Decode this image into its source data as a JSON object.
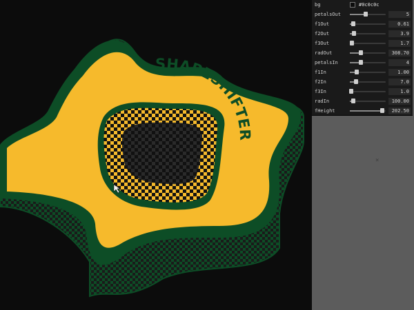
{
  "colors": {
    "background": "#0c0c0c",
    "ring": "#0d4d26",
    "text": "#f6ba2c",
    "checker_dark": "#1a1a1a"
  },
  "canvas_text": "SHAPESHIFTER",
  "gui": {
    "bg": {
      "label": "bg",
      "value": "#0c0c0c"
    },
    "controls": [
      {
        "label": "petalsOut",
        "value": "5",
        "level": 0.45
      },
      {
        "label": "f1Out",
        "value": "0.61",
        "level": 0.1
      },
      {
        "label": "f2Out",
        "value": "3.9",
        "level": 0.12
      },
      {
        "label": "f3Out",
        "value": "1.7",
        "level": 0.05
      },
      {
        "label": "radOut",
        "value": "308.70",
        "level": 0.3
      },
      {
        "label": "petalsIn",
        "value": "4",
        "level": 0.3
      },
      {
        "label": "f1In",
        "value": "1.00",
        "level": 0.2
      },
      {
        "label": "f2In",
        "value": "7.0",
        "level": 0.18
      },
      {
        "label": "f3In",
        "value": "1.0",
        "level": 0.03
      },
      {
        "label": "radIn",
        "value": "100.00",
        "level": 0.1
      },
      {
        "label": "fHeight",
        "value": "202.50",
        "level": 0.9
      }
    ]
  }
}
